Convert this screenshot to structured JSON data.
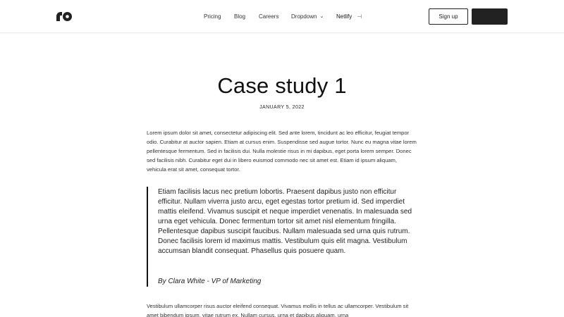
{
  "header": {
    "logo": "logo-icon",
    "nav": {
      "pricing": "Pricing",
      "blog": "Blog",
      "careers": "Careers",
      "dropdown": "Dropdown",
      "netlify": "Netlify"
    },
    "signup_label": "Sign up",
    "dark_button_label": ""
  },
  "post": {
    "title": "Case study 1",
    "date": "JANUARY 5, 2022",
    "paragraph_1": "Lorem ipsum dolor sit amet, consectetur adipiscing elit. Sed ante lorem, tincidunt ac leo efficitur, feugiat tempor odio. Curabitur at auctor sapien. Etiam at cursus enim. Suspendisse sed augue tortor. Nunc eu magna vitae lorem pellentesque fermentum. Sed in facilisis dui. Nulla molestie risus in mi dapibus, eget porta lorem semper. Donec sed facilisis nibh. Curabitur eget dui in libero euismod commodo nec sit amet est. Etiam id ipsum aliquam, vehicula erat sit amet, consequat tortor.",
    "quote": "Etiam facilisis lacus nec pretium lobortis. Praesent dapibus justo non efficitur efficitur. Nullam viverra justo arcu, eget egestas tortor pretium id. Sed imperdiet mattis eleifend. Vivamus suscipit et neque imperdiet venenatis. In malesuada sed urna eget vehicula. Donec fermentum tortor sit amet nisl elementum fringilla. Pellentesque dapibus suscipit faucibus. Nullam malesuada sed urna quis rutrum. Donec facilisis lorem id maximus mattis. Vestibulum quis elit magna. Vestibulum accumsan blandit consequat. Phasellus quis posuere quam.",
    "quote_author": "By Clara White - VP of Marketing",
    "paragraph_2": "Vestibulum ullamcorper risus auctor eleifend consequat. Vivamus mollis in tellus ac ullamcorper. Vestibulum sit amet bibendum ipsum, vitae rutrum ex. Nullam cursus, urna et dapibus aliquam, urna"
  },
  "icons": {
    "dropdown": "chevron-down-icon",
    "netlify": "external-link-icon"
  },
  "colors": {
    "accent_dark": "#222222",
    "background": "#ffffff"
  }
}
